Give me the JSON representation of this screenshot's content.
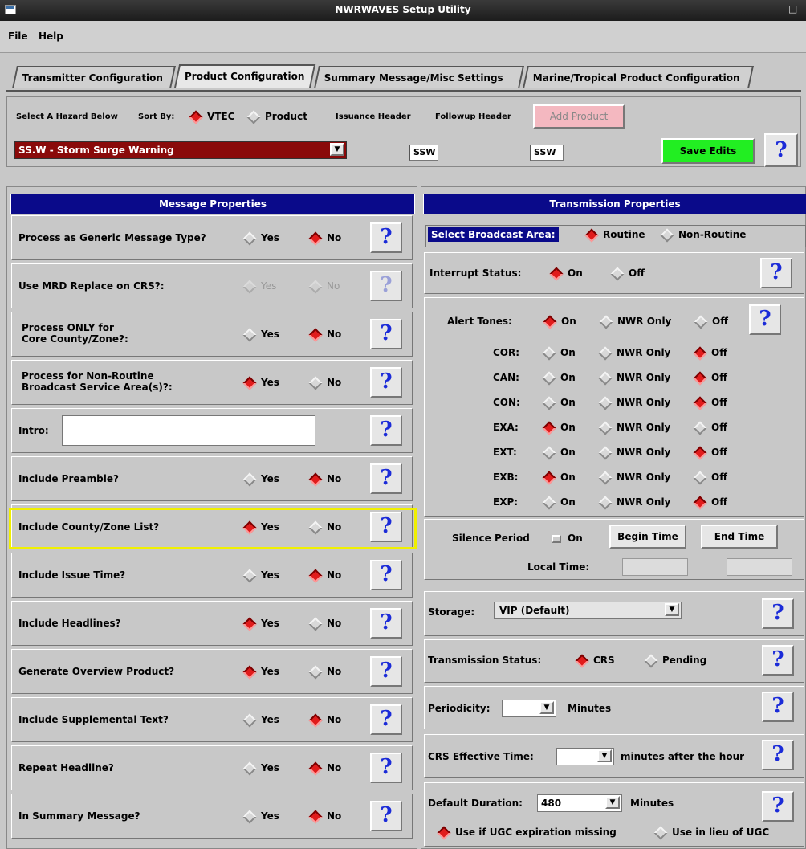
{
  "window": {
    "title": "NWRWAVES Setup Utility",
    "min": "_",
    "max": "□"
  },
  "menu": [
    "File",
    "Help"
  ],
  "tabs": [
    "Transmitter Configuration",
    "Product Configuration",
    "Summary Message/Misc Settings",
    "Marine/Tropical Product Configuration"
  ],
  "hazard": {
    "select_label": "Select A Hazard Below",
    "sort_by": "Sort By:",
    "sort_vtec": "VTEC",
    "sort_product": "Product",
    "issuance_header": "Issuance Header",
    "followup_header": "Followup Header",
    "add_product": "Add Product",
    "selected": "SS.W - Storm Surge Warning",
    "issuance_value": "SSW",
    "followup_value": "SSW",
    "save_edits": "Save Edits"
  },
  "message_properties": {
    "title": "Message Properties",
    "yes": "Yes",
    "no": "No",
    "rows": [
      {
        "label": "Process as Generic Message Type?",
        "value": "No"
      },
      {
        "label": "Use MRD Replace on CRS?:",
        "value": "none"
      },
      {
        "label": "Process ONLY for\nCore County/Zone?:",
        "value": "No"
      },
      {
        "label": "Process for Non-Routine\nBroadcast Service Area(s)?:",
        "value": "Yes"
      },
      {
        "label": "Intro:",
        "value": ""
      },
      {
        "label": "Include Preamble?",
        "value": "No"
      },
      {
        "label": "Include County/Zone List?",
        "value": "Yes"
      },
      {
        "label": "Include Issue Time?",
        "value": "No"
      },
      {
        "label": "Include Headlines?",
        "value": "Yes"
      },
      {
        "label": "Generate Overview Product?",
        "value": "Yes"
      },
      {
        "label": "Include Supplemental Text?",
        "value": "No"
      },
      {
        "label": "Repeat Headline?",
        "value": "No"
      },
      {
        "label": "In Summary Message?",
        "value": "No"
      }
    ]
  },
  "transmission_properties": {
    "title": "Transmission Properties",
    "broadcast_area_label": "Select Broadcast Area:",
    "routine": "Routine",
    "non_routine": "Non-Routine",
    "interrupt_label": "Interrupt Status:",
    "on": "On",
    "off": "Off",
    "nwr_only": "NWR Only",
    "alert_tones_label": "Alert Tones:",
    "tones": [
      {
        "code": "COR:",
        "value": "Off"
      },
      {
        "code": "CAN:",
        "value": "Off"
      },
      {
        "code": "CON:",
        "value": "Off"
      },
      {
        "code": "EXA:",
        "value": "On"
      },
      {
        "code": "EXT:",
        "value": "Off"
      },
      {
        "code": "EXB:",
        "value": "On"
      },
      {
        "code": "EXP:",
        "value": "Off"
      }
    ],
    "silence_period": "Silence Period",
    "begin_time": "Begin Time",
    "end_time": "End Time",
    "local_time": "Local Time:",
    "storage_label": "Storage:",
    "storage_value": "VIP (Default)",
    "tx_status_label": "Transmission Status:",
    "crs": "CRS",
    "pending": "Pending",
    "periodicity_label": "Periodicity:",
    "minutes": "Minutes",
    "crs_eff_label": "CRS Effective Time:",
    "after_hour": "minutes after the hour",
    "default_duration_label": "Default Duration:",
    "default_duration_value": "480",
    "use_if_missing": "Use if UGC expiration missing",
    "use_in_lieu": "Use in lieu of UGC"
  },
  "colors": {
    "highlight": "#f0f000",
    "accent": "#0a0a8a",
    "save": "#22ee22",
    "hazard_bg": "#8a0a0a",
    "add_product": "#f4b8c0"
  }
}
